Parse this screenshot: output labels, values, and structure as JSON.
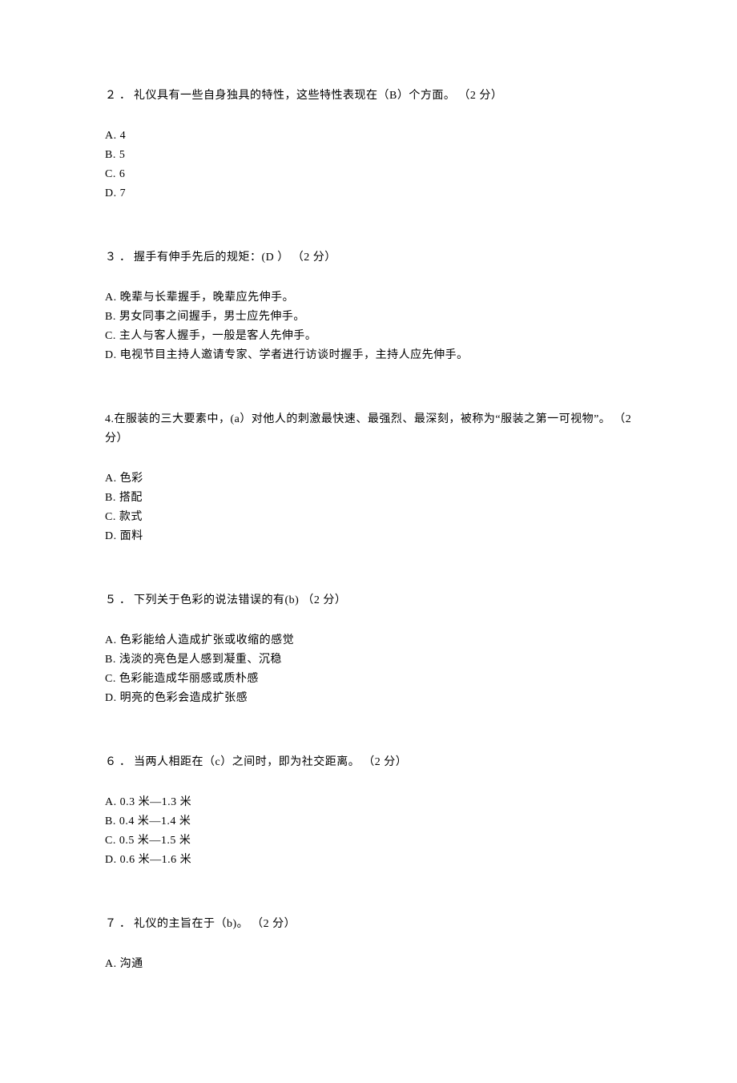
{
  "questions": [
    {
      "num": "２．",
      "text": "礼仪具有一些自身独具的特性，这些特性表现在（B）个方面。 （2 分）",
      "options": [
        "A.  4",
        "B.  5",
        "C.  6",
        "D.  7"
      ]
    },
    {
      "num": "３．",
      "text": "握手有伸手先后的规矩：(D ） （2 分）",
      "options": [
        "A.  晚辈与长辈握手，晚辈应先伸手。",
        "B.  男女同事之间握手，男士应先伸手。",
        "C.  主人与客人握手，一般是客人先伸手。",
        "D.  电视节目主持人邀请专家、学者进行访谈时握手，主持人应先伸手。"
      ]
    },
    {
      "num": "4.",
      "text": "在服装的三大要素中，(a）对他人的刺激最快速、最强烈、最深刻，被称为“服装之第一可视物”。 （2 分）",
      "options": [
        "A.  色彩",
        "B.  搭配",
        "C.  款式",
        "D.  面料"
      ]
    },
    {
      "num": "５．",
      "text": "下列关于色彩的说法错误的有(b) （2 分）",
      "options": [
        "A.  色彩能给人造成扩张或收缩的感觉",
        "B.  浅淡的亮色是人感到凝重、沉稳",
        "C.  色彩能造成华丽感或质朴感",
        "D.  明亮的色彩会造成扩张感"
      ]
    },
    {
      "num": "６．",
      "text": "当两人相距在（c）之间时，即为社交距离。 （2 分）",
      "options": [
        "A.  0.3 米—1.3 米",
        "B.  0.4 米—1.4 米",
        "C.  0.5 米—1.5 米",
        "D.  0.6 米—1.6 米"
      ]
    },
    {
      "num": "７．",
      "text": "礼仪的主旨在于（b)。 （2 分）",
      "options": [
        "A.  沟通"
      ]
    }
  ]
}
